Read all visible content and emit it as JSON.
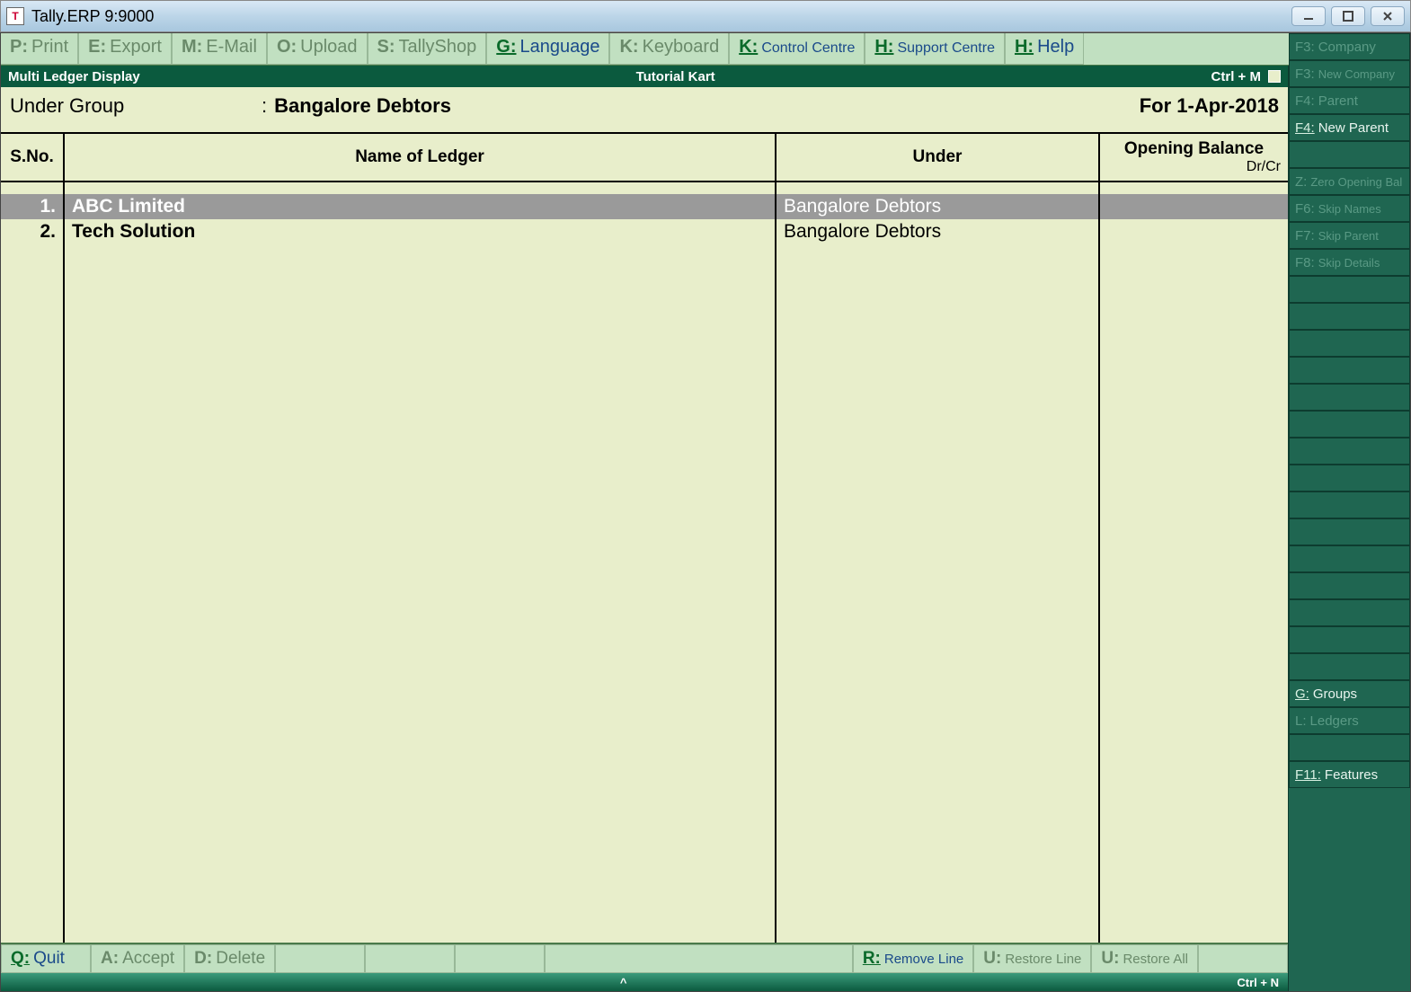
{
  "window": {
    "title": "Tally.ERP 9:9000"
  },
  "topmenu": [
    {
      "key": "P:",
      "label": "Print",
      "enabled": false,
      "small": false
    },
    {
      "key": "E:",
      "label": "Export",
      "enabled": false,
      "small": false
    },
    {
      "key": "M:",
      "label": "E-Mail",
      "enabled": false,
      "small": false
    },
    {
      "key": "O:",
      "label": "Upload",
      "enabled": false,
      "small": false
    },
    {
      "key": "S:",
      "label": "TallyShop",
      "enabled": false,
      "small": false
    },
    {
      "key": "G:",
      "label": "Language",
      "enabled": true,
      "small": false
    },
    {
      "key": "K:",
      "label": "Keyboard",
      "enabled": false,
      "small": false
    },
    {
      "key": "K:",
      "label": "Control Centre",
      "enabled": true,
      "small": true
    },
    {
      "key": "H:",
      "label": "Support Centre",
      "enabled": true,
      "small": true
    },
    {
      "key": "H:",
      "label": "Help",
      "enabled": true,
      "small": false
    }
  ],
  "subheader": {
    "left": "Multi Ledger  Display",
    "center": "Tutorial Kart",
    "right": "Ctrl + M"
  },
  "info": {
    "label": "Under Group",
    "value": "Bangalore Debtors",
    "date": "For 1-Apr-2018"
  },
  "table": {
    "headers": {
      "sno": "S.No.",
      "name": "Name of Ledger",
      "under": "Under",
      "opbal": "Opening Balance",
      "drcr": "Dr/Cr"
    },
    "rows": [
      {
        "sno": "1.",
        "name": "ABC Limited",
        "under": "Bangalore Debtors",
        "opbal": "",
        "selected": true
      },
      {
        "sno": "2.",
        "name": "Tech Solution",
        "under": "Bangalore Debtors",
        "opbal": "",
        "selected": false
      }
    ]
  },
  "bottommenu": [
    {
      "key": "Q:",
      "label": "Quit",
      "enabled": true,
      "small": false
    },
    {
      "key": "A:",
      "label": "Accept",
      "enabled": false,
      "small": false
    },
    {
      "key": "D:",
      "label": "Delete",
      "enabled": false,
      "small": false
    }
  ],
  "bottommenu_right": [
    {
      "key": "R:",
      "label": "Remove Line",
      "enabled": true,
      "small": true
    },
    {
      "key": "U:",
      "label": "Restore Line",
      "enabled": false,
      "small": true
    },
    {
      "key": "U:",
      "label": "Restore All",
      "enabled": false,
      "small": true
    }
  ],
  "statusbar": {
    "center": "^",
    "right": "Ctrl + N"
  },
  "sidepanel": [
    {
      "key": "F3:",
      "label": "Company",
      "enabled": false
    },
    {
      "key": "F3:",
      "label": "New Company",
      "enabled": false,
      "small": true
    },
    {
      "key": "F4:",
      "label": "Parent",
      "enabled": false
    },
    {
      "key": "F4:",
      "label": "New Parent",
      "enabled": true
    },
    {
      "type": "spacer"
    },
    {
      "key": "Z:",
      "label": "Zero Opening Bal",
      "enabled": false,
      "small": true
    },
    {
      "key": "F6:",
      "label": "Skip Names",
      "enabled": false,
      "small": true
    },
    {
      "key": "F7:",
      "label": "Skip Parent",
      "enabled": false,
      "small": true
    },
    {
      "key": "F8:",
      "label": "Skip Details",
      "enabled": false,
      "small": true
    },
    {
      "type": "spacer"
    },
    {
      "type": "spacer"
    },
    {
      "type": "spacer"
    },
    {
      "type": "spacer"
    },
    {
      "type": "spacer"
    },
    {
      "type": "spacer"
    },
    {
      "type": "spacer"
    },
    {
      "type": "spacer"
    },
    {
      "type": "spacer"
    },
    {
      "type": "spacer"
    },
    {
      "type": "spacer"
    },
    {
      "type": "spacer"
    },
    {
      "type": "spacer"
    },
    {
      "type": "spacer"
    },
    {
      "type": "spacer"
    },
    {
      "key": "G:",
      "label": "Groups",
      "enabled": true
    },
    {
      "key": "L:",
      "label": "Ledgers",
      "enabled": false
    },
    {
      "type": "spacer"
    },
    {
      "key": "F11:",
      "label": "Features",
      "enabled": true
    }
  ]
}
